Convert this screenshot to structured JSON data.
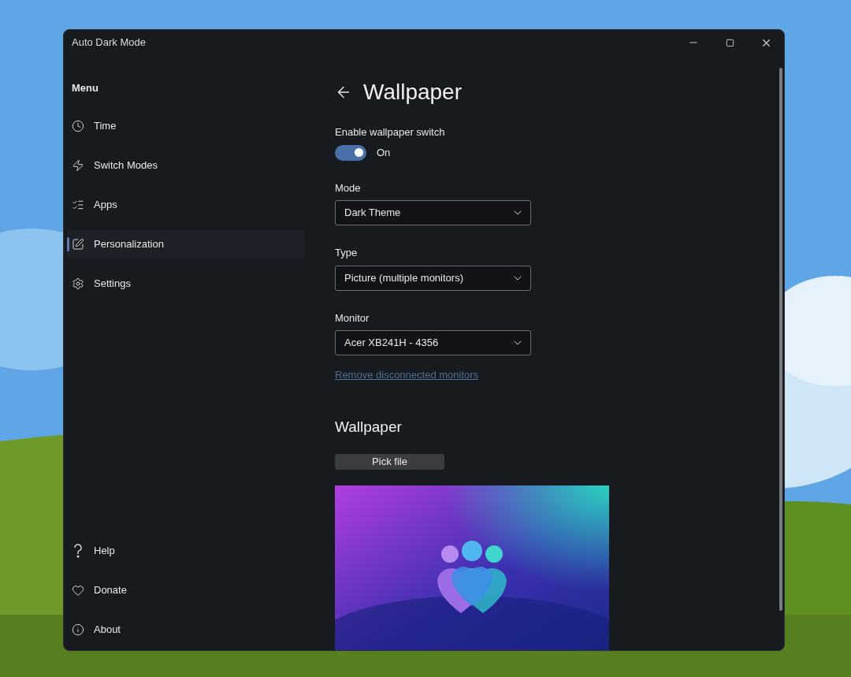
{
  "window": {
    "title": "Auto Dark Mode"
  },
  "sidebar": {
    "title": "Menu",
    "items": [
      {
        "label": "Time",
        "selected": false
      },
      {
        "label": "Switch Modes",
        "selected": false
      },
      {
        "label": "Apps",
        "selected": false
      },
      {
        "label": "Personalization",
        "selected": true
      },
      {
        "label": "Settings",
        "selected": false
      }
    ],
    "footer_items": [
      {
        "label": "Help"
      },
      {
        "label": "Donate"
      },
      {
        "label": "About"
      }
    ]
  },
  "page": {
    "title": "Wallpaper",
    "toggle": {
      "label": "Enable wallpaper switch",
      "on": true,
      "state_text": "On"
    },
    "dropdowns": [
      {
        "label": "Mode",
        "value": "Dark Theme"
      },
      {
        "label": "Type",
        "value": "Picture (multiple monitors)"
      },
      {
        "label": "Monitor",
        "value": "Acer XB241H - 4356"
      }
    ],
    "link": "Remove disconnected monitors",
    "section_title": "Wallpaper",
    "button": "Pick file"
  }
}
